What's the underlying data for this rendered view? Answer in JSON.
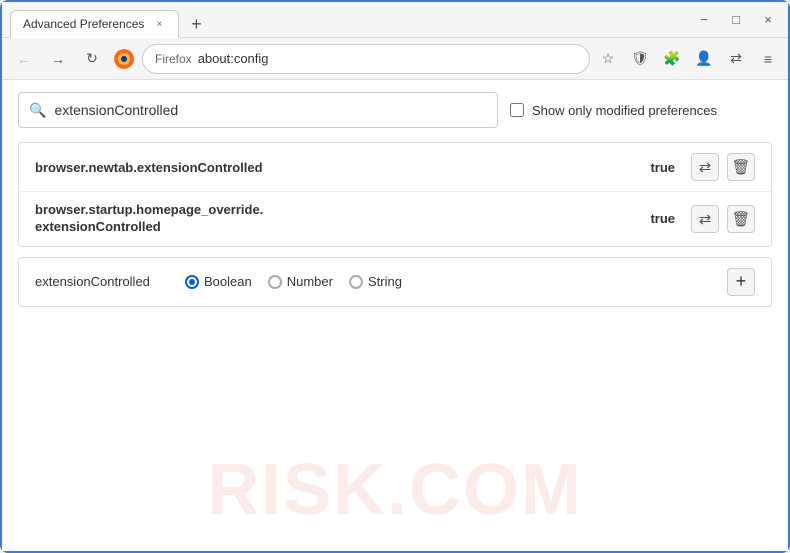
{
  "window": {
    "title": "Advanced Preferences",
    "tab_close_label": "×",
    "new_tab_label": "+",
    "minimize_label": "−",
    "maximize_label": "□",
    "close_label": "×"
  },
  "nav": {
    "back_label": "←",
    "forward_label": "→",
    "reload_label": "↻",
    "browser_name": "Firefox",
    "url": "about:config",
    "bookmark_icon": "☆",
    "shield_icon": "🛡",
    "extension_icon": "🧩",
    "profile_icon": "👤",
    "sync_icon": "⇄",
    "menu_icon": "≡"
  },
  "search": {
    "placeholder": "extensionControlled",
    "value": "extensionControlled",
    "modified_label": "Show only modified preferences"
  },
  "results": [
    {
      "name": "browser.newtab.extensionControlled",
      "value": "true"
    },
    {
      "name_line1": "browser.startup.homepage_override.",
      "name_line2": "extensionControlled",
      "value": "true"
    }
  ],
  "add_row": {
    "name": "extensionControlled",
    "type_boolean": "Boolean",
    "type_number": "Number",
    "type_string": "String",
    "add_icon": "+"
  },
  "watermark": "RISK.COM"
}
